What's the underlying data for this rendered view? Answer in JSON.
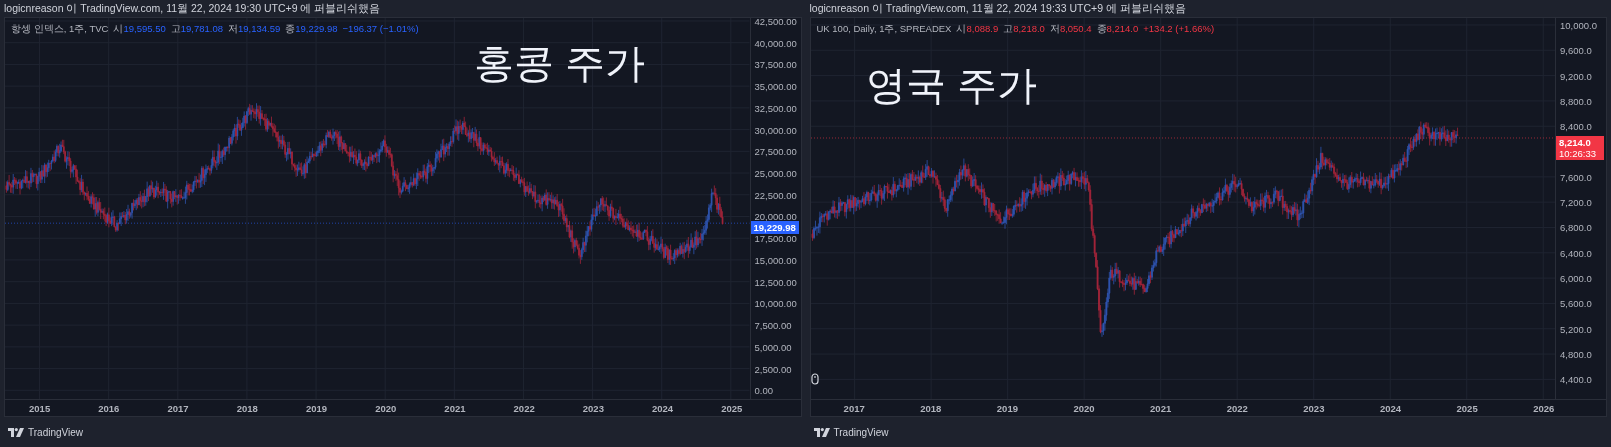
{
  "panels": [
    {
      "header": "logicnreason 이 TradingView.com, 11월 22, 2024 19:30 UTC+9 에 퍼블리쉬했음",
      "color": "#2962ff",
      "legend": {
        "symbol": "항셍 인덱스, 1주, TVC",
        "values": [
          {
            "label": "시",
            "value": "19,595.50"
          },
          {
            "label": "고",
            "value": "19,781.08"
          },
          {
            "label": "저",
            "value": "19,134.59"
          },
          {
            "label": "종",
            "value": "19,229.98"
          }
        ],
        "change": "−196.37 (−1.01%)"
      },
      "title": "홍콩 주가",
      "price_axis": [
        "42,500.00",
        "40,000.00",
        "37,500.00",
        "35,000.00",
        "32,500.00",
        "30,000.00",
        "27,500.00",
        "25,000.00",
        "22,500.00",
        "20,000.00",
        "17,500.00",
        "15,000.00",
        "12,500.00",
        "10,000.00",
        "7,500.00",
        "5,000.00",
        "2,500.00",
        "0.00"
      ],
      "badge": [
        "19,229.98"
      ],
      "time_axis": [
        "2015",
        "2016",
        "2017",
        "2018",
        "2019",
        "2020",
        "2021",
        "2022",
        "2023",
        "2024",
        "2025"
      ],
      "footer": "TradingView"
    },
    {
      "header": "logicnreason 이 TradingView.com, 11월 22, 2024 19:33 UTC+9 에 퍼블리쉬했음",
      "color": "#f23645",
      "legend": {
        "symbol": "UK 100, Daily, 1주, SPREADEX",
        "values": [
          {
            "label": "시",
            "value": "8,088.9"
          },
          {
            "label": "고",
            "value": "8,218.0"
          },
          {
            "label": "저",
            "value": "8,050.4"
          },
          {
            "label": "종",
            "value": "8,214.0"
          }
        ],
        "change": "+134.2 (+1.66%)"
      },
      "title": "영국 주가",
      "price_axis": [
        "10,000.0",
        "9,600.0",
        "9,200.0",
        "8,800.0",
        "8,400.0",
        "7,600.0",
        "7,200.0",
        "6,800.0",
        "6,400.0",
        "6,000.0",
        "5,600.0",
        "5,200.0",
        "4,800.0",
        "4,400.0"
      ],
      "badge": [
        "8,214.0",
        "10:26:33"
      ],
      "time_axis": [
        "2017",
        "2018",
        "2019",
        "2020",
        "2021",
        "2022",
        "2023",
        "2024",
        "2025",
        "2026"
      ],
      "footer": "TradingView"
    }
  ]
}
